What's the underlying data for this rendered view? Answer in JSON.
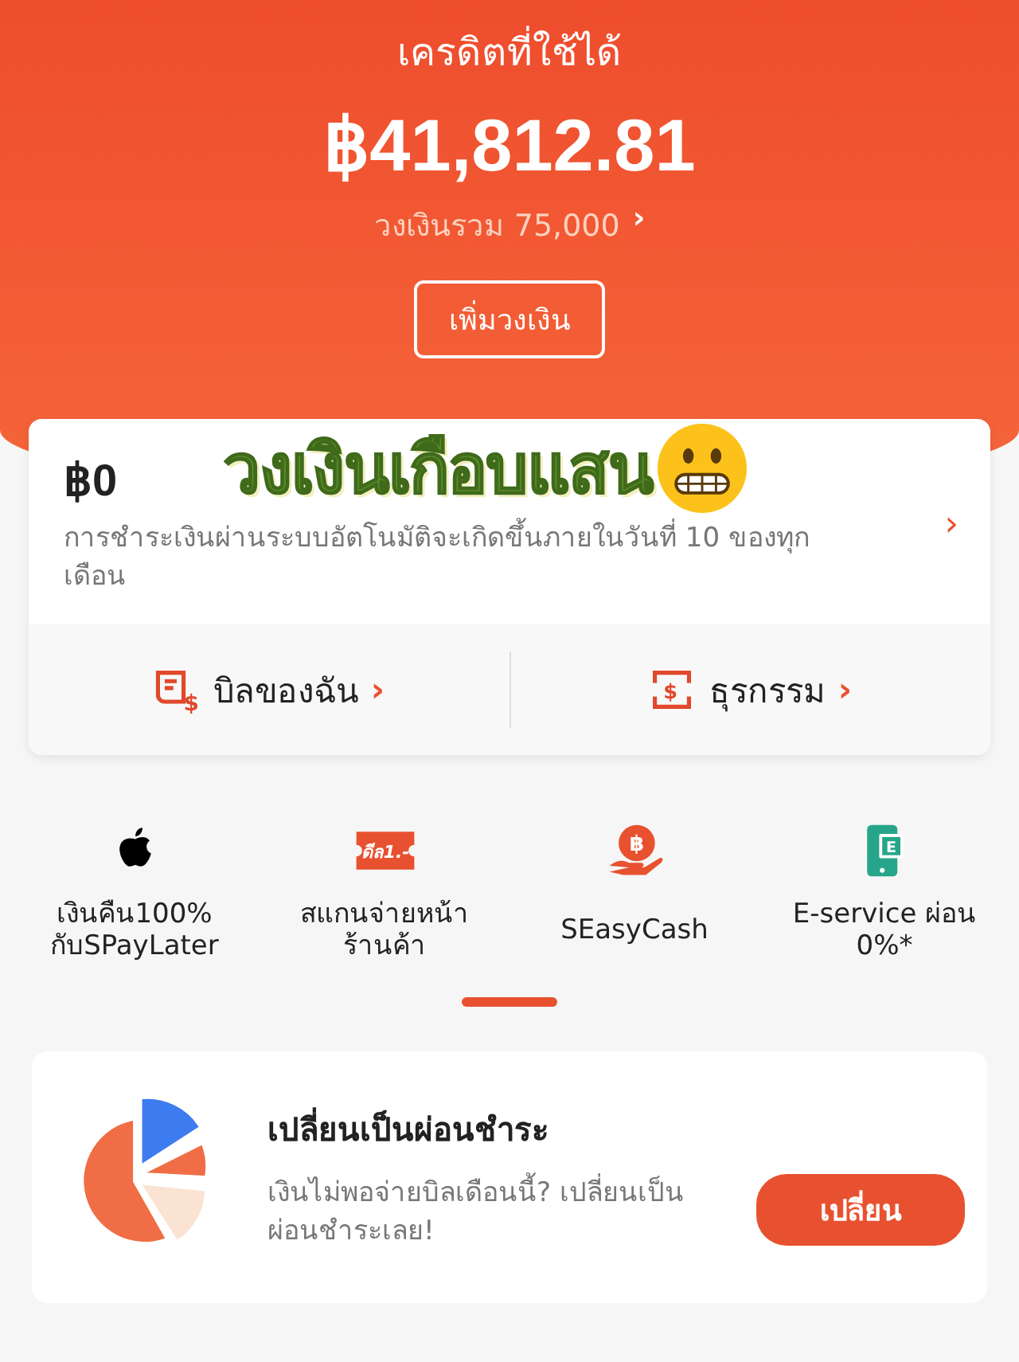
{
  "header": {
    "title": "เครดิตที่ใช้ได้",
    "amount": "฿41,812.81",
    "total_limit": "วงเงินรวม 75,000",
    "total_limit_arrow": "›",
    "increase_button": "เพิ่มวงเงิน"
  },
  "overlay_caption": {
    "text": "วงเงินเกือบแสน"
  },
  "bill_card": {
    "amount": "฿0",
    "note": "การชำระเงินผ่านระบบอัตโนมัติจะเกิดขึ้นภายในวันที่ 10 ของทุกเดือน",
    "arrow": "›",
    "links": [
      {
        "kind": "bill",
        "icon_text": "$",
        "label": "บิลของฉัน",
        "arrow": "›"
      },
      {
        "kind": "transactions",
        "icon_text": "$",
        "label": "ธุรกรรม",
        "arrow": "›"
      }
    ]
  },
  "shortcuts": [
    {
      "kind": "apple",
      "label": "เงินคืน100% กับSPayLater"
    },
    {
      "kind": "deal",
      "icon_text": "ดีล1.-",
      "label": "สแกนจ่ายหน้า ร้านค้า"
    },
    {
      "kind": "cash",
      "icon_text": "฿",
      "label": "SEasyCash"
    },
    {
      "kind": "eservice",
      "icon_text": "E",
      "label": "E-service ผ่อน 0%*"
    }
  ],
  "shortcut_pages": [
    {
      "selected": true
    }
  ],
  "installment_card": {
    "title": "เปลี่ยนเป็นผ่อนชำระ",
    "text": "เงินไม่พอจ่ายบิลเดือนนี้? เปลี่ยนเป็นผ่อนชำระเลย!",
    "button": "เปลี่ยน"
  }
}
